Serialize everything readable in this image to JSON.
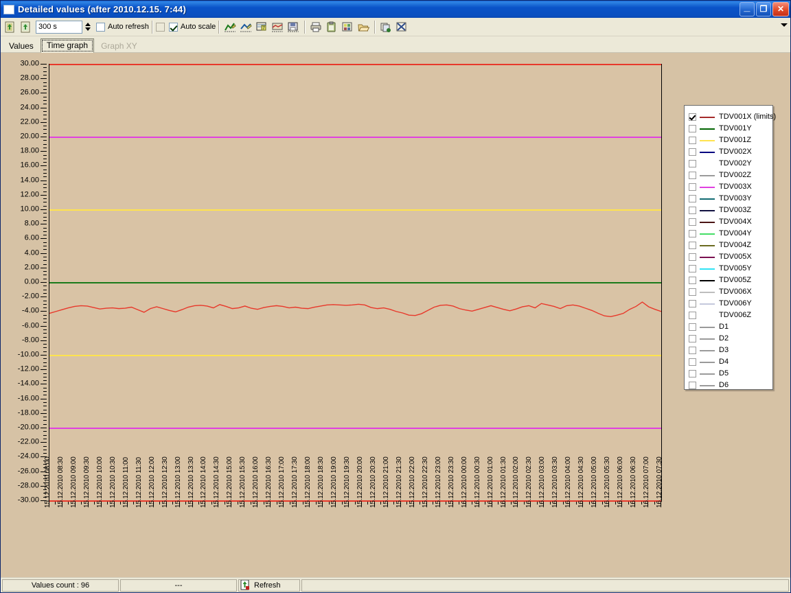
{
  "window": {
    "title": "Detailed values (after 2010.12.15. 7:44)",
    "icon": "window-icon",
    "minimize_label": "_",
    "maximize_label": "❐",
    "close_label": "✕"
  },
  "toolbar": {
    "icons": [
      {
        "name": "load-values-icon",
        "title": "Load values"
      },
      {
        "name": "refresh-values-icon",
        "title": "Refresh values"
      }
    ],
    "period_value": "300 s",
    "period_placeholder": "300 s",
    "spinner_name": "period-spinner",
    "auto_refresh_label": "Auto refresh",
    "auto_refresh_checked": false,
    "auto_scale_extra_checked": false,
    "auto_scale_label": "Auto scale",
    "auto_scale_checked": true,
    "graph_icons": [
      {
        "name": "graph-line-icon"
      },
      {
        "name": "graph-edit-icon"
      },
      {
        "name": "graph-table-icon"
      },
      {
        "name": "graph-area-icon"
      },
      {
        "name": "graph-save-icon"
      }
    ],
    "action_icons": [
      {
        "name": "print-icon"
      },
      {
        "name": "clipboard-icon"
      },
      {
        "name": "export-icon"
      },
      {
        "name": "open-folder-icon"
      }
    ],
    "right_icons": [
      {
        "name": "copy-pages-icon"
      },
      {
        "name": "excel-export-icon"
      }
    ],
    "overflow_icon": "chevron-down-icon"
  },
  "tabs": [
    {
      "label": "Values",
      "selected": false,
      "disabled": false
    },
    {
      "label": "Time graph",
      "selected": true,
      "disabled": false
    },
    {
      "label": "Graph XY",
      "selected": false,
      "disabled": true
    }
  ],
  "legend": {
    "items": [
      {
        "label": "TDV001X (limits)",
        "color": "#a52a2a",
        "checked": true
      },
      {
        "label": "TDV001Y",
        "color": "#006400",
        "checked": false
      },
      {
        "label": "TDV001Z",
        "color": "#ffe34d",
        "checked": false
      },
      {
        "label": "TDV002X",
        "color": "#000080",
        "checked": false
      },
      {
        "label": "TDV002Y",
        "color": "#ffffff",
        "checked": false
      },
      {
        "label": "TDV002Z",
        "color": "#9a9a9a",
        "checked": false
      },
      {
        "label": "TDV003X",
        "color": "#e040e0",
        "checked": false
      },
      {
        "label": "TDV003Y",
        "color": "#116a72",
        "checked": false
      },
      {
        "label": "TDV003Z",
        "color": "#101040",
        "checked": false
      },
      {
        "label": "TDV004X",
        "color": "#4a1414",
        "checked": false
      },
      {
        "label": "TDV004Y",
        "color": "#44dd66",
        "checked": false
      },
      {
        "label": "TDV004Z",
        "color": "#6b6b20",
        "checked": false
      },
      {
        "label": "TDV005X",
        "color": "#7a1050",
        "checked": false
      },
      {
        "label": "TDV005Y",
        "color": "#2fe3f5",
        "checked": false
      },
      {
        "label": "TDV005Z",
        "color": "#000000",
        "checked": false
      },
      {
        "label": "TDV006X",
        "color": "#bdbdbd",
        "checked": false
      },
      {
        "label": "TDV006Y",
        "color": "#c4c8dc",
        "checked": false
      },
      {
        "label": "TDV006Z",
        "color": "#ffffff",
        "checked": false
      },
      {
        "label": "D1",
        "color": "#9a9a9a",
        "checked": false
      },
      {
        "label": "D2",
        "color": "#9a9a9a",
        "checked": false
      },
      {
        "label": "D3",
        "color": "#9a9a9a",
        "checked": false
      },
      {
        "label": "D4",
        "color": "#9a9a9a",
        "checked": false
      },
      {
        "label": "D5",
        "color": "#9a9a9a",
        "checked": false
      },
      {
        "label": "D6",
        "color": "#9a9a9a",
        "checked": false
      }
    ]
  },
  "statusbar": {
    "values_count": "Values count : 96",
    "middle": "---",
    "refresh_label": "Refresh",
    "refresh_icon": "refresh-icon"
  },
  "chart_data": {
    "type": "line",
    "title": "",
    "xlabel": "",
    "ylabel": "",
    "ylim": [
      -30,
      30
    ],
    "ytick_step": 2,
    "grid": false,
    "legend_position": "right",
    "background": "#d9c3a5",
    "ytick_labels": [
      "30.00",
      "28.00",
      "26.00",
      "24.00",
      "22.00",
      "20.00",
      "18.00",
      "16.00",
      "14.00",
      "12.00",
      "10.00",
      "8.00",
      "6.00",
      "4.00",
      "2.00",
      "0.00",
      "-2.00",
      "-4.00",
      "-6.00",
      "-8.00",
      "-10.00",
      "-12.00",
      "-14.00",
      "-16.00",
      "-18.00",
      "-20.00",
      "-22.00",
      "-24.00",
      "-26.00",
      "-28.00",
      "-30.00"
    ],
    "ytick_values": [
      30,
      28,
      26,
      24,
      22,
      20,
      18,
      16,
      14,
      12,
      10,
      8,
      6,
      4,
      2,
      0,
      -2,
      -4,
      -6,
      -8,
      -10,
      -12,
      -14,
      -16,
      -18,
      -20,
      -22,
      -24,
      -26,
      -28,
      -30
    ],
    "xtick_labels": [
      "15.12.2010 08:00",
      "15.12.2010 08:30",
      "15.12.2010 09:00",
      "15.12.2010 09:30",
      "15.12.2010 10:00",
      "15.12.2010 10:30",
      "15.12.2010 11:00",
      "15.12.2010 11:30",
      "15.12.2010 12:00",
      "15.12.2010 12:30",
      "15.12.2010 13:00",
      "15.12.2010 13:30",
      "15.12.2010 14:00",
      "15.12.2010 14:30",
      "15.12.2010 15:00",
      "15.12.2010 15:30",
      "15.12.2010 16:00",
      "15.12.2010 16:30",
      "15.12.2010 17:00",
      "15.12.2010 17:30",
      "15.12.2010 18:00",
      "15.12.2010 18:30",
      "15.12.2010 19:00",
      "15.12.2010 19:30",
      "15.12.2010 20:00",
      "15.12.2010 20:30",
      "15.12.2010 21:00",
      "15.12.2010 21:30",
      "15.12.2010 22:00",
      "15.12.2010 22:30",
      "15.12.2010 23:00",
      "15.12.2010 23:30",
      "16.12.2010 00:00",
      "16.12.2010 00:30",
      "16.12.2010 01:00",
      "16.12.2010 01:30",
      "16.12.2010 02:00",
      "16.12.2010 02:30",
      "16.12.2010 03:00",
      "16.12.2010 03:30",
      "16.12.2010 04:00",
      "16.12.2010 04:30",
      "16.12.2010 05:00",
      "16.12.2010 05:30",
      "16.12.2010 06:00",
      "16.12.2010 06:30",
      "16.12.2010 07:00",
      "16.12.2010 07:30"
    ],
    "limit_lines": [
      {
        "name": "upper-alarm",
        "value": 30,
        "color": "#e8382a",
        "width": 2
      },
      {
        "name": "upper-warning",
        "value": 20,
        "color": "#e040e0",
        "width": 2
      },
      {
        "name": "upper-caution",
        "value": 10,
        "color": "#ffe34d",
        "width": 2
      },
      {
        "name": "zero-reference",
        "value": 0,
        "color": "#1a7a1a",
        "width": 2
      },
      {
        "name": "lower-caution",
        "value": -10,
        "color": "#ffe34d",
        "width": 2
      },
      {
        "name": "lower-warning",
        "value": -20,
        "color": "#e040e0",
        "width": 2
      },
      {
        "name": "lower-alarm",
        "value": -30,
        "color": "#e8382a",
        "width": 2
      }
    ],
    "series": [
      {
        "name": "TDV001X (limits)",
        "color": "#e8382a",
        "values": [
          -4.2,
          -3.95,
          -3.7,
          -3.45,
          -3.25,
          -3.15,
          -3.2,
          -3.4,
          -3.6,
          -3.5,
          -3.45,
          -3.55,
          -3.5,
          -3.35,
          -3.7,
          -4.05,
          -3.55,
          -3.3,
          -3.55,
          -3.8,
          -4.0,
          -3.7,
          -3.35,
          -3.15,
          -3.1,
          -3.2,
          -3.45,
          -3.0,
          -3.25,
          -3.55,
          -3.45,
          -3.2,
          -3.5,
          -3.65,
          -3.4,
          -3.25,
          -3.15,
          -3.25,
          -3.45,
          -3.35,
          -3.5,
          -3.55,
          -3.35,
          -3.2,
          -3.05,
          -3.0,
          -3.05,
          -3.1,
          -3.05,
          -2.95,
          -3.05,
          -3.4,
          -3.55,
          -3.45,
          -3.65,
          -3.95,
          -4.15,
          -4.45,
          -4.5,
          -4.25,
          -3.8,
          -3.35,
          -3.1,
          -3.05,
          -3.2,
          -3.55,
          -3.75,
          -3.9,
          -3.65,
          -3.4,
          -3.15,
          -3.4,
          -3.65,
          -3.85,
          -3.6,
          -3.3,
          -3.15,
          -3.45,
          -2.85,
          -3.05,
          -3.25,
          -3.55,
          -3.15,
          -3.05,
          -3.2,
          -3.5,
          -3.8,
          -4.2,
          -4.55,
          -4.65,
          -4.45,
          -4.2,
          -3.65,
          -3.25,
          -2.65,
          -3.3,
          -3.65,
          -3.95
        ]
      }
    ]
  }
}
